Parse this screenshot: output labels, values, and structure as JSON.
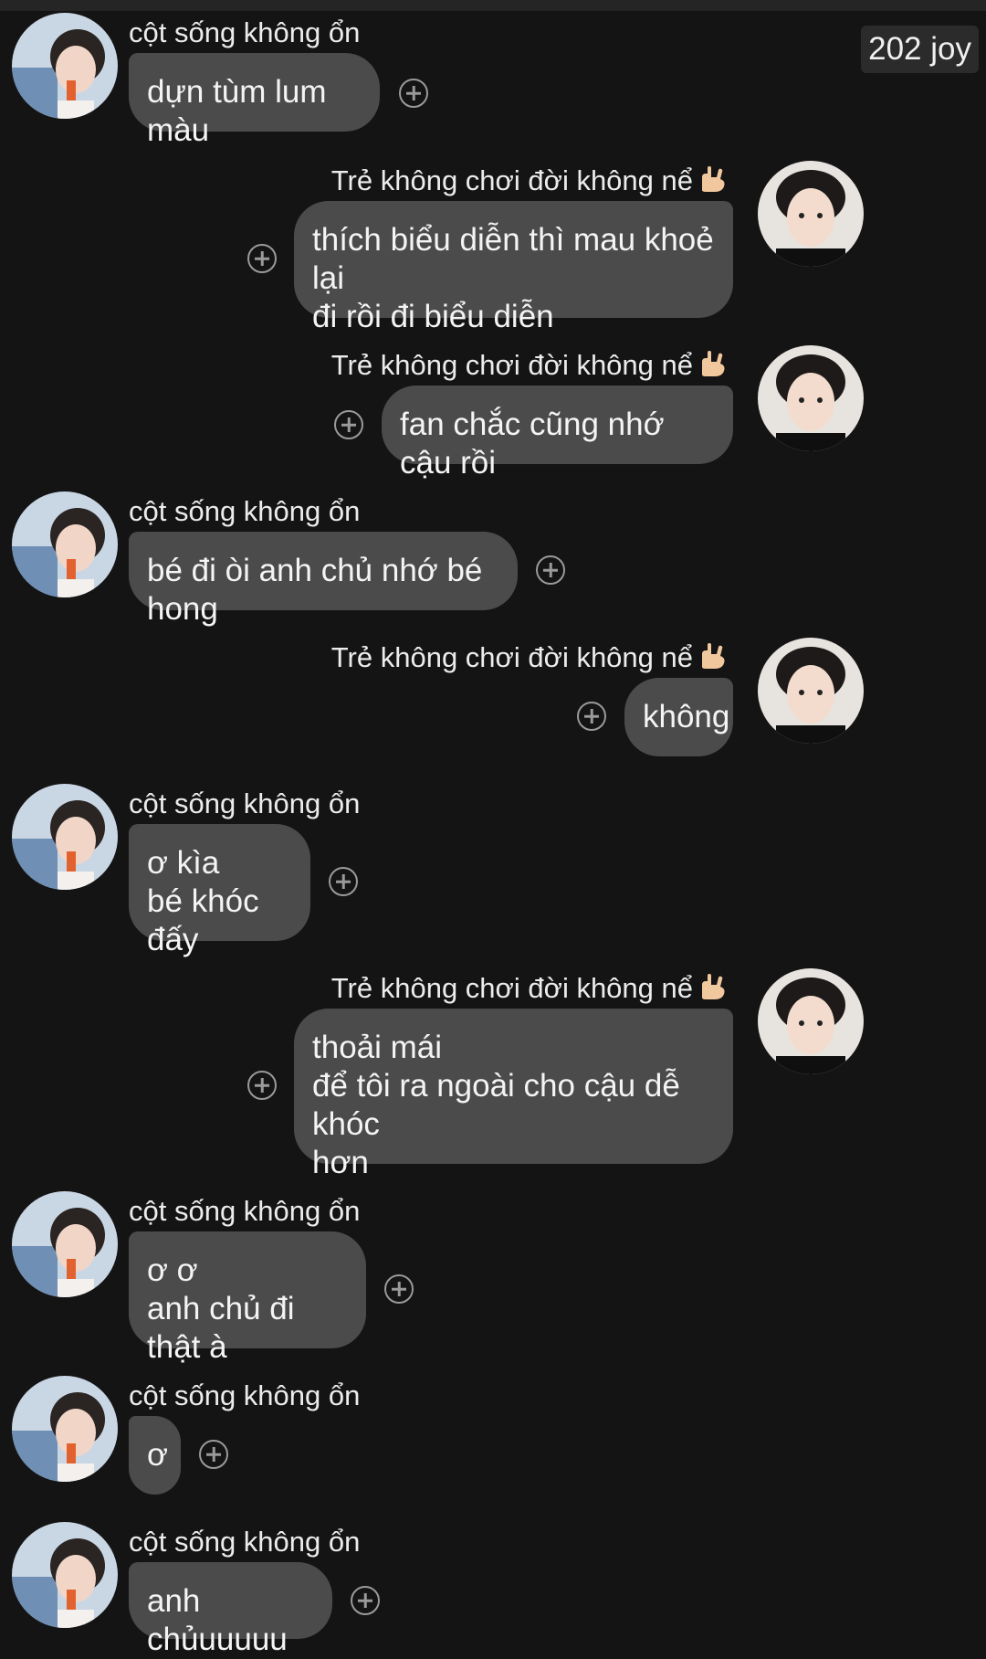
{
  "badge": {
    "label": "202 joy"
  },
  "senders": {
    "left_name": "cột sống không ổn",
    "right_name": "Trẻ không chơi đời không nể"
  },
  "messages": [
    {
      "side": "left",
      "text": "dựn tùm lum màu"
    },
    {
      "side": "right",
      "text": "thích biểu diễn thì mau khoẻ lại\nđi rồi đi biểu diễn"
    },
    {
      "side": "right",
      "text": "fan chắc cũng nhớ cậu rồi"
    },
    {
      "side": "left",
      "text": "bé đi òi anh chủ nhớ bé hong"
    },
    {
      "side": "right",
      "text": "không"
    },
    {
      "side": "left",
      "text": "ơ kìa\nbé khóc đấy"
    },
    {
      "side": "right",
      "text": "thoải mái\nđể tôi ra ngoài cho cậu dễ khóc\nhơn"
    },
    {
      "side": "left",
      "text": "ơ ơ\nanh chủ đi thật à"
    },
    {
      "side": "left",
      "text": "ơ"
    },
    {
      "side": "left",
      "text": "anh chủuuuuu"
    }
  ],
  "icons": {
    "add_reaction": "plus-circle-icon",
    "sender_badge": "rock-on-hand-icon"
  },
  "colors": {
    "background": "#141414",
    "bubble": "#4b4b4b",
    "text": "#f4f4f4"
  }
}
